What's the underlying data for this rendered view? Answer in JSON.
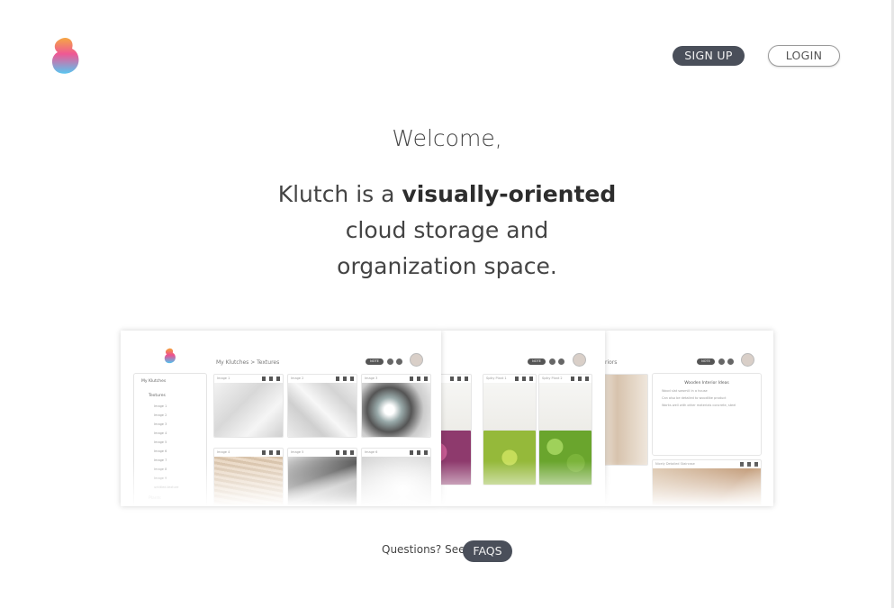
{
  "header": {
    "logo_icon": "klutch-logo-icon",
    "signup_label": "SIGN UP",
    "login_label": "LOGIN"
  },
  "hero": {
    "welcome": "Welcome,",
    "line1_prefix": "Klutch is a ",
    "line1_bold": "visually-oriented",
    "line2": "cloud storage and",
    "line3": "organization space."
  },
  "preview": {
    "breadcrumb": "My Klutches > Textures",
    "note_badge": "NOTE",
    "sidebar_title": "My Klutches",
    "sidebar_folder": "Textures",
    "sidebar_items": [
      "Image 1",
      "Image 2",
      "Image 3",
      "Image 4",
      "Image 5",
      "Image 6",
      "Image 7",
      "Image 8",
      "Image 9",
      "untitled-texture"
    ],
    "sidebar_more": "Plants",
    "texture_cards": [
      "Image 1",
      "Image 2",
      "Image 3",
      "Image 4",
      "Image 5",
      "Image 6"
    ],
    "plant_cards": [
      "Spiky Plant 1",
      "Spiky Plant 2",
      "Spiky Plant 3"
    ],
    "interiors_crumb": "riors",
    "note_title": "Wooden Interior Ideas",
    "note_lines": [
      "Wood slat sawmill in a house",
      "Can also be detailed to woodlike product",
      "Works well with other materials concrete, steel"
    ],
    "wood_card": "Nicely Detailed Staircase"
  },
  "footer": {
    "question": "Questions? See",
    "faq_label": "FAQS"
  },
  "colors": {
    "dark_button": "#4a4f5a",
    "text": "#444444",
    "logo_top": "#f28a3c",
    "logo_mid": "#ee4f8f",
    "logo_bottom": "#4fc3f0"
  }
}
